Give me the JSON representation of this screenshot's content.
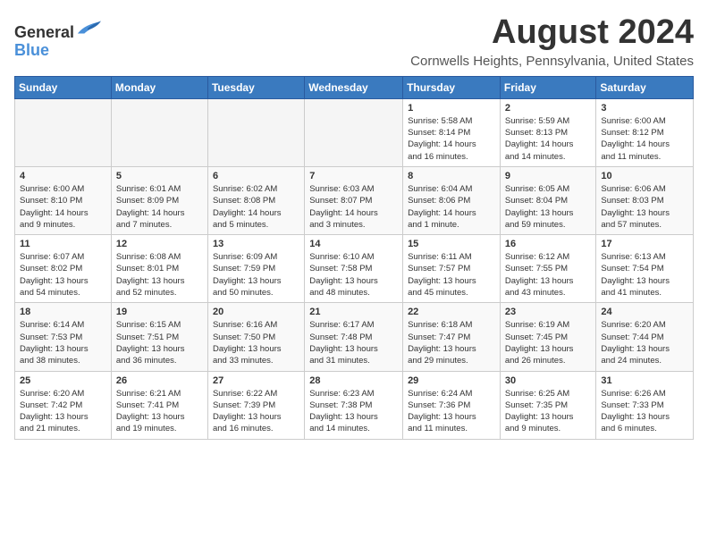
{
  "header": {
    "logo_general": "General",
    "logo_blue": "Blue",
    "title": "August 2024",
    "subtitle": "Cornwells Heights, Pennsylvania, United States"
  },
  "calendar": {
    "days_of_week": [
      "Sunday",
      "Monday",
      "Tuesday",
      "Wednesday",
      "Thursday",
      "Friday",
      "Saturday"
    ],
    "weeks": [
      [
        {
          "day": "",
          "info": ""
        },
        {
          "day": "",
          "info": ""
        },
        {
          "day": "",
          "info": ""
        },
        {
          "day": "",
          "info": ""
        },
        {
          "day": "1",
          "info": "Sunrise: 5:58 AM\nSunset: 8:14 PM\nDaylight: 14 hours\nand 16 minutes."
        },
        {
          "day": "2",
          "info": "Sunrise: 5:59 AM\nSunset: 8:13 PM\nDaylight: 14 hours\nand 14 minutes."
        },
        {
          "day": "3",
          "info": "Sunrise: 6:00 AM\nSunset: 8:12 PM\nDaylight: 14 hours\nand 11 minutes."
        }
      ],
      [
        {
          "day": "4",
          "info": "Sunrise: 6:00 AM\nSunset: 8:10 PM\nDaylight: 14 hours\nand 9 minutes."
        },
        {
          "day": "5",
          "info": "Sunrise: 6:01 AM\nSunset: 8:09 PM\nDaylight: 14 hours\nand 7 minutes."
        },
        {
          "day": "6",
          "info": "Sunrise: 6:02 AM\nSunset: 8:08 PM\nDaylight: 14 hours\nand 5 minutes."
        },
        {
          "day": "7",
          "info": "Sunrise: 6:03 AM\nSunset: 8:07 PM\nDaylight: 14 hours\nand 3 minutes."
        },
        {
          "day": "8",
          "info": "Sunrise: 6:04 AM\nSunset: 8:06 PM\nDaylight: 14 hours\nand 1 minute."
        },
        {
          "day": "9",
          "info": "Sunrise: 6:05 AM\nSunset: 8:04 PM\nDaylight: 13 hours\nand 59 minutes."
        },
        {
          "day": "10",
          "info": "Sunrise: 6:06 AM\nSunset: 8:03 PM\nDaylight: 13 hours\nand 57 minutes."
        }
      ],
      [
        {
          "day": "11",
          "info": "Sunrise: 6:07 AM\nSunset: 8:02 PM\nDaylight: 13 hours\nand 54 minutes."
        },
        {
          "day": "12",
          "info": "Sunrise: 6:08 AM\nSunset: 8:01 PM\nDaylight: 13 hours\nand 52 minutes."
        },
        {
          "day": "13",
          "info": "Sunrise: 6:09 AM\nSunset: 7:59 PM\nDaylight: 13 hours\nand 50 minutes."
        },
        {
          "day": "14",
          "info": "Sunrise: 6:10 AM\nSunset: 7:58 PM\nDaylight: 13 hours\nand 48 minutes."
        },
        {
          "day": "15",
          "info": "Sunrise: 6:11 AM\nSunset: 7:57 PM\nDaylight: 13 hours\nand 45 minutes."
        },
        {
          "day": "16",
          "info": "Sunrise: 6:12 AM\nSunset: 7:55 PM\nDaylight: 13 hours\nand 43 minutes."
        },
        {
          "day": "17",
          "info": "Sunrise: 6:13 AM\nSunset: 7:54 PM\nDaylight: 13 hours\nand 41 minutes."
        }
      ],
      [
        {
          "day": "18",
          "info": "Sunrise: 6:14 AM\nSunset: 7:53 PM\nDaylight: 13 hours\nand 38 minutes."
        },
        {
          "day": "19",
          "info": "Sunrise: 6:15 AM\nSunset: 7:51 PM\nDaylight: 13 hours\nand 36 minutes."
        },
        {
          "day": "20",
          "info": "Sunrise: 6:16 AM\nSunset: 7:50 PM\nDaylight: 13 hours\nand 33 minutes."
        },
        {
          "day": "21",
          "info": "Sunrise: 6:17 AM\nSunset: 7:48 PM\nDaylight: 13 hours\nand 31 minutes."
        },
        {
          "day": "22",
          "info": "Sunrise: 6:18 AM\nSunset: 7:47 PM\nDaylight: 13 hours\nand 29 minutes."
        },
        {
          "day": "23",
          "info": "Sunrise: 6:19 AM\nSunset: 7:45 PM\nDaylight: 13 hours\nand 26 minutes."
        },
        {
          "day": "24",
          "info": "Sunrise: 6:20 AM\nSunset: 7:44 PM\nDaylight: 13 hours\nand 24 minutes."
        }
      ],
      [
        {
          "day": "25",
          "info": "Sunrise: 6:20 AM\nSunset: 7:42 PM\nDaylight: 13 hours\nand 21 minutes."
        },
        {
          "day": "26",
          "info": "Sunrise: 6:21 AM\nSunset: 7:41 PM\nDaylight: 13 hours\nand 19 minutes."
        },
        {
          "day": "27",
          "info": "Sunrise: 6:22 AM\nSunset: 7:39 PM\nDaylight: 13 hours\nand 16 minutes."
        },
        {
          "day": "28",
          "info": "Sunrise: 6:23 AM\nSunset: 7:38 PM\nDaylight: 13 hours\nand 14 minutes."
        },
        {
          "day": "29",
          "info": "Sunrise: 6:24 AM\nSunset: 7:36 PM\nDaylight: 13 hours\nand 11 minutes."
        },
        {
          "day": "30",
          "info": "Sunrise: 6:25 AM\nSunset: 7:35 PM\nDaylight: 13 hours\nand 9 minutes."
        },
        {
          "day": "31",
          "info": "Sunrise: 6:26 AM\nSunset: 7:33 PM\nDaylight: 13 hours\nand 6 minutes."
        }
      ]
    ]
  }
}
